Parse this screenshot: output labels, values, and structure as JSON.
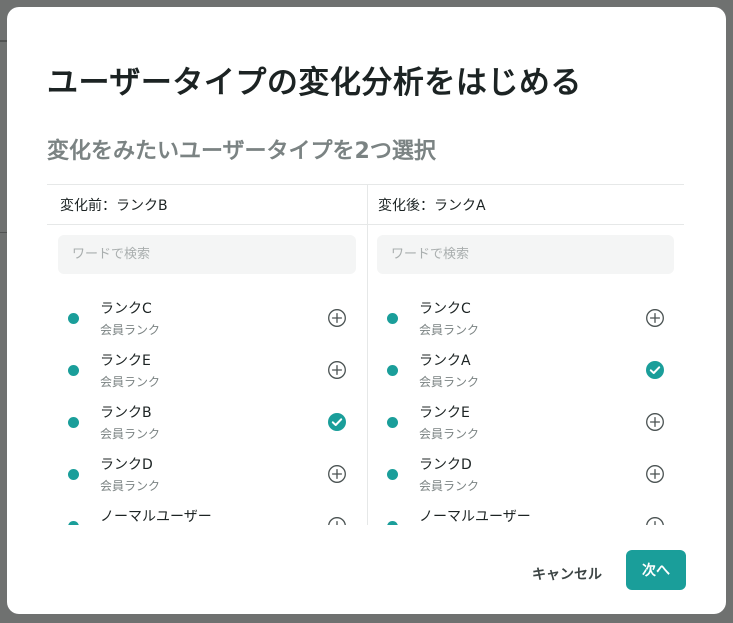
{
  "modal": {
    "title": "ユーザータイプの変化分析をはじめる",
    "subtitle": "変化をみたいユーザータイプを2つ選択"
  },
  "before_panel": {
    "header": "変化前：ランクB",
    "search_placeholder": "ワードで検索",
    "items": [
      {
        "name": "ランクC",
        "type": "会員ランク",
        "state": "add",
        "color": "#1a9e9a"
      },
      {
        "name": "ランクE",
        "type": "会員ランク",
        "state": "add",
        "color": "#1a9e9a"
      },
      {
        "name": "ランクB",
        "type": "会員ランク",
        "state": "selected",
        "color": "#1a9e9a"
      },
      {
        "name": "ランクD",
        "type": "会員ランク",
        "state": "add",
        "color": "#1a9e9a"
      },
      {
        "name": "ノーマルユーザー",
        "type": "",
        "state": "add",
        "color": "#1a9e9a"
      }
    ]
  },
  "after_panel": {
    "header": "変化後：ランクA",
    "search_placeholder": "ワードで検索",
    "items": [
      {
        "name": "ランクC",
        "type": "会員ランク",
        "state": "add",
        "color": "#1a9e9a"
      },
      {
        "name": "ランクA",
        "type": "会員ランク",
        "state": "selected",
        "color": "#1a9e9a"
      },
      {
        "name": "ランクE",
        "type": "会員ランク",
        "state": "add",
        "color": "#1a9e9a"
      },
      {
        "name": "ランクD",
        "type": "会員ランク",
        "state": "add",
        "color": "#1a9e9a"
      },
      {
        "name": "ノーマルユーザー",
        "type": "",
        "state": "add",
        "color": "#1a9e9a"
      }
    ]
  },
  "footer": {
    "cancel_label": "キャンセル",
    "next_label": "次へ"
  },
  "icons": {
    "add": "plus-circle-icon",
    "selected": "check-circle-icon"
  },
  "colors": {
    "accent": "#1a9e9a",
    "overlay": "#6f7170"
  }
}
